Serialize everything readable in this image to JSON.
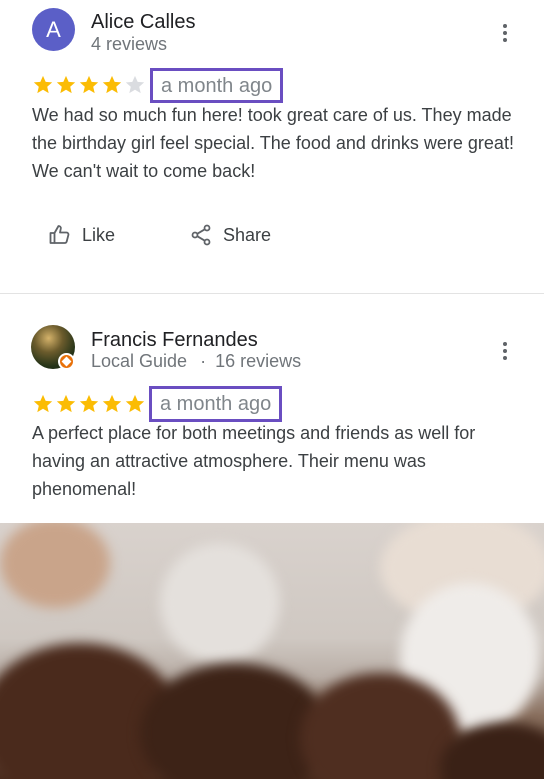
{
  "reviews": [
    {
      "avatar_letter": "A",
      "avatar_color": "#5b5fc7",
      "name": "Alice Calles",
      "meta": "4 reviews",
      "rating": 4,
      "max_rating": 5,
      "time": "a month ago",
      "text": "We had so much fun here! took great care of us. They made the birthday girl feel special. The food and drinks were great! We can't wait to come back!",
      "actions": {
        "like": "Like",
        "share": "Share"
      }
    },
    {
      "name": "Francis Fernandes",
      "badge": "Local Guide",
      "separator": "·",
      "meta": "16 reviews",
      "rating": 5,
      "max_rating": 5,
      "time": "a month ago",
      "text": "A perfect place for both meetings and friends as well for having an attractive atmosphere. Their menu was phenomenal!"
    }
  ],
  "colors": {
    "star_filled": "#fbbc04",
    "star_empty": "#dadce0",
    "highlight_border": "#6a4ec1",
    "local_guide_badge": "#e8710a"
  },
  "icons": [
    "more-vert-icon",
    "thumb-up-icon",
    "share-icon",
    "star-icon",
    "local-guide-badge-icon"
  ]
}
